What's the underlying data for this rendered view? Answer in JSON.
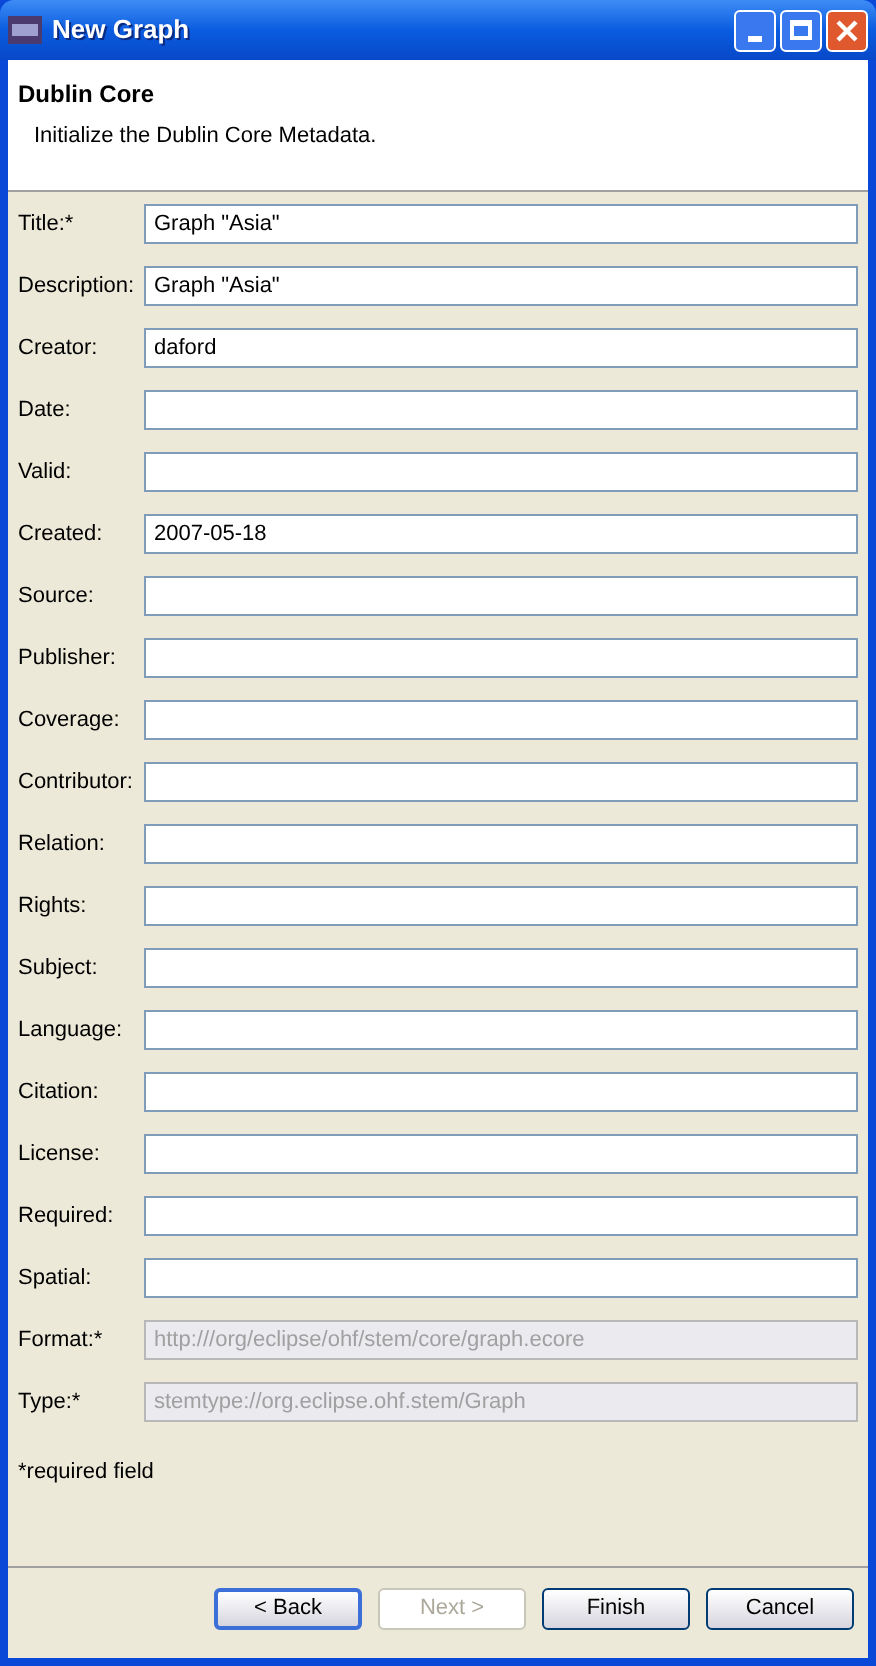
{
  "window": {
    "title": "New Graph"
  },
  "header": {
    "title": "Dublin Core",
    "description": "Initialize the Dublin Core Metadata."
  },
  "fields": [
    {
      "label": "Title:*",
      "value": "Graph \"Asia\"",
      "disabled": false
    },
    {
      "label": "Description:",
      "value": "Graph \"Asia\"",
      "disabled": false
    },
    {
      "label": "Creator:",
      "value": "daford",
      "disabled": false
    },
    {
      "label": "Date:",
      "disabled": false
    },
    {
      "label": "Valid:",
      "disabled": false
    },
    {
      "label": "Created:",
      "value": "2007-05-18",
      "disabled": false
    },
    {
      "label": "Source:",
      "disabled": false
    },
    {
      "label": "Publisher:",
      "disabled": false
    },
    {
      "label": "Coverage:",
      "disabled": false
    },
    {
      "label": "Contributor:",
      "disabled": false
    },
    {
      "label": "Relation:",
      "disabled": false
    },
    {
      "label": "Rights:",
      "disabled": false
    },
    {
      "label": "Subject:",
      "disabled": false
    },
    {
      "label": "Language:",
      "disabled": false
    },
    {
      "label": "Citation:",
      "disabled": false
    },
    {
      "label": "License:",
      "disabled": false
    },
    {
      "label": "Required:",
      "disabled": false
    },
    {
      "label": "Spatial:",
      "disabled": false
    },
    {
      "label": "Format:*",
      "value": "http:///org/eclipse/ohf/stem/core/graph.ecore",
      "disabled": true
    },
    {
      "label": "Type:*",
      "value": "stemtype://org.eclipse.ohf.stem/Graph",
      "disabled": true
    }
  ],
  "note": "*required field",
  "buttons": [
    {
      "label": "< Back",
      "disabled": false,
      "focused": true
    },
    {
      "label": "Next >",
      "disabled": true,
      "focused": false
    },
    {
      "label": "Finish",
      "disabled": false,
      "focused": false
    },
    {
      "label": "Cancel",
      "disabled": false,
      "focused": false
    }
  ]
}
